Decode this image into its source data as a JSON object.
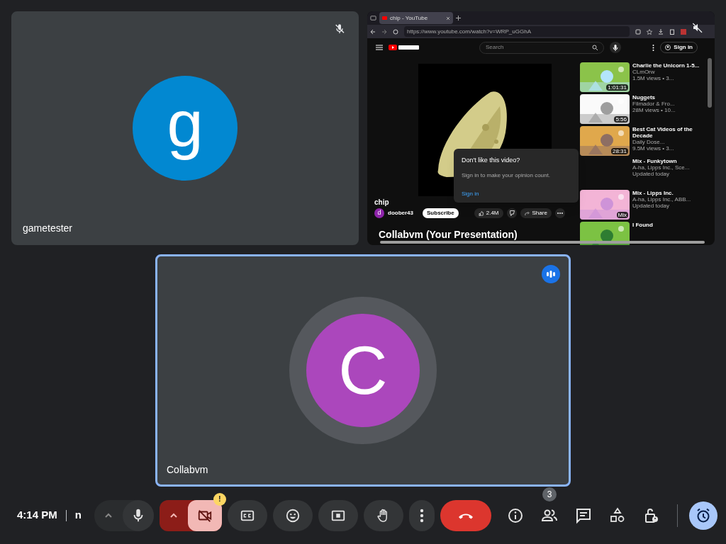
{
  "tiles": [
    {
      "kind": "avatar",
      "name": "gametester",
      "initial": "g",
      "color": "#0288d1",
      "muted": true,
      "speaking": false
    },
    {
      "kind": "presentation",
      "name": "Collabvm (Your Presentation)",
      "muted": true,
      "browser": {
        "tab_title": "chip - YouTube",
        "url": "https://www.youtube.com/watch?v=WRP_uGGhA",
        "page": {
          "search_placeholder": "Search",
          "sign_in": "Sign in",
          "video_title": "chip",
          "channel": "doober43",
          "channel_initial": "d",
          "subscribe": "Subscribe",
          "likes": "2.4M",
          "share": "Share",
          "popup": {
            "title": "Don't like this video?",
            "text": "Sign in to make your opinion count.",
            "link": "Sign in"
          },
          "recommendations": [
            {
              "title": "Charlie the Unicorn 1-5...",
              "channel": "CLmOrw",
              "meta": "1.5M views • 3...",
              "duration": "1:01:31"
            },
            {
              "title": "Nuggets",
              "channel": "Filmador & Fro...",
              "meta": "28M views • 10...",
              "duration": "5:56"
            },
            {
              "title": "Best Cat Videos of the Decade",
              "channel": "Daily Dose...",
              "meta": "9.5M views • 3...",
              "duration": "28:31"
            },
            {
              "title": "Mix - Funkytown",
              "channel": "A-ha, Lipps Inc., Sce...",
              "meta": "Updated today"
            },
            {
              "title": "Mix - Lipps Inc.",
              "channel": "A-ha, Lipps Inc., ABB...",
              "meta": "Updated today",
              "badge": "Mix"
            },
            {
              "title": "I Found"
            }
          ]
        }
      }
    },
    {
      "kind": "avatar",
      "name": "Collabvm",
      "initial": "C",
      "color": "#ab47bc",
      "speaking": true
    }
  ],
  "bar": {
    "time": "4:14 PM",
    "meeting_code": "n",
    "controls": [
      {
        "kind": "mic",
        "off": false
      },
      {
        "kind": "camera",
        "off": true,
        "badge": "!"
      },
      {
        "kind": "captions"
      },
      {
        "kind": "emoji"
      },
      {
        "kind": "present"
      },
      {
        "kind": "hand"
      },
      {
        "kind": "more"
      },
      {
        "kind": "end"
      }
    ],
    "side": [
      {
        "kind": "info",
        "selected": false
      },
      {
        "kind": "people",
        "selected": false,
        "badge": "3"
      },
      {
        "kind": "chat",
        "selected": false
      },
      {
        "kind": "activities",
        "selected": false
      },
      {
        "kind": "lock",
        "selected": false
      },
      {
        "kind": "timer",
        "selected": true
      }
    ]
  }
}
